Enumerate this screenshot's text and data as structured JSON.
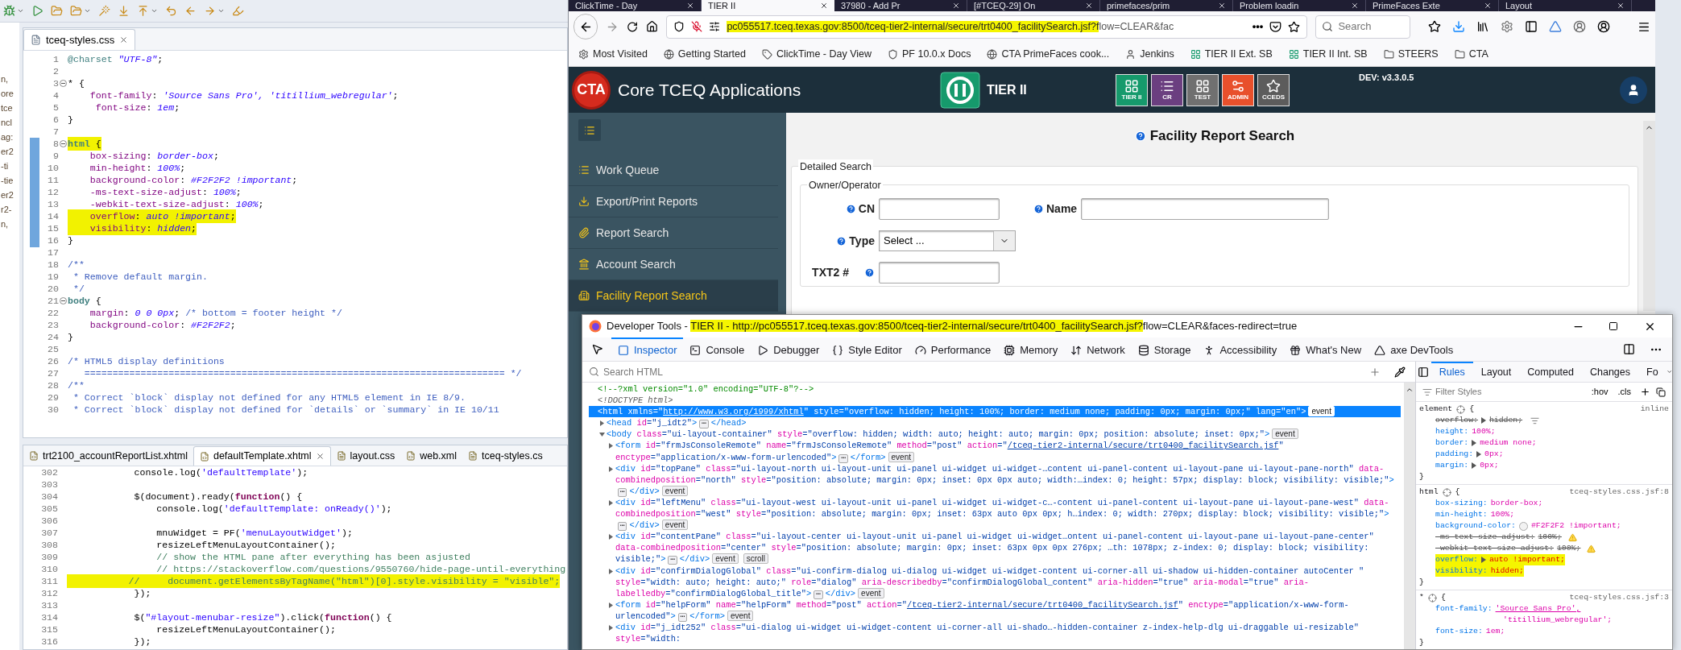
{
  "ide": {
    "explorer_fragments": [
      "n,",
      "ore",
      "tce",
      "ncl",
      "ag:",
      "er2",
      "-ti",
      "-tie",
      "er2",
      "r2-",
      "n,"
    ],
    "top_editor": {
      "tabs": [
        {
          "label": "tceq-styles.css",
          "selected": true
        }
      ],
      "lines": [
        {
          "number": "1",
          "foldable": false,
          "marked": false,
          "segments": [
            {
              "text": "@charset ",
              "kind": "at-rule"
            },
            {
              "text": "\"UTF-8\"",
              "kind": "value"
            },
            {
              "text": ";",
              "kind": "plain"
            }
          ]
        },
        {
          "number": "2",
          "foldable": false,
          "marked": false
        },
        {
          "number": "3",
          "foldable": true,
          "marked": false,
          "segments": [
            {
              "text": "* {",
              "kind": "plain"
            }
          ]
        },
        {
          "number": "4",
          "foldable": false,
          "marked": false,
          "segments": [
            {
              "text": "    font-family",
              "kind": "property"
            },
            {
              "text": ": ",
              "kind": "plain"
            },
            {
              "text": "'Source Sans Pro', 'titillium_webregular'",
              "kind": "value"
            },
            {
              "text": ";",
              "kind": "plain"
            }
          ]
        },
        {
          "number": "5",
          "foldable": false,
          "marked": false,
          "segments": [
            {
              "text": "     font-size",
              "kind": "property"
            },
            {
              "text": ": ",
              "kind": "plain"
            },
            {
              "text": "1em",
              "kind": "value"
            },
            {
              "text": ";",
              "kind": "plain"
            }
          ]
        },
        {
          "number": "6",
          "foldable": false,
          "marked": false,
          "segments": [
            {
              "text": "}",
              "kind": "plain"
            }
          ]
        },
        {
          "number": "7",
          "foldable": false,
          "marked": false
        },
        {
          "number": "8",
          "foldable": true,
          "marked": true,
          "segments": [
            {
              "text": "html",
              "kind": "selector"
            },
            {
              "text": " {",
              "kind": "plain"
            }
          ]
        },
        {
          "number": "9",
          "foldable": false,
          "marked": false,
          "segments": [
            {
              "text": "    box-sizing",
              "kind": "property"
            },
            {
              "text": ": ",
              "kind": "plain"
            },
            {
              "text": "border-box",
              "kind": "value"
            },
            {
              "text": ";",
              "kind": "plain"
            }
          ]
        },
        {
          "number": "10",
          "foldable": false,
          "marked": false,
          "segments": [
            {
              "text": "    min-height",
              "kind": "property"
            },
            {
              "text": ": ",
              "kind": "plain"
            },
            {
              "text": "100%",
              "kind": "value"
            },
            {
              "text": ";",
              "kind": "plain"
            }
          ]
        },
        {
          "number": "11",
          "foldable": false,
          "marked": false,
          "segments": [
            {
              "text": "    background-color",
              "kind": "property"
            },
            {
              "text": ": ",
              "kind": "plain"
            },
            {
              "text": "#F2F2F2 !important",
              "kind": "value"
            },
            {
              "text": ";",
              "kind": "plain"
            }
          ]
        },
        {
          "number": "12",
          "foldable": false,
          "marked": false,
          "segments": [
            {
              "text": "    -ms-text-size-adjust",
              "kind": "property"
            },
            {
              "text": ": ",
              "kind": "plain"
            },
            {
              "text": "100%",
              "kind": "value"
            },
            {
              "text": ";",
              "kind": "plain"
            }
          ]
        },
        {
          "number": "13",
          "foldable": false,
          "marked": false,
          "segments": [
            {
              "text": "    -webkit-text-size-adjust",
              "kind": "property"
            },
            {
              "text": ": ",
              "kind": "plain"
            },
            {
              "text": "100%",
              "kind": "value"
            },
            {
              "text": ";",
              "kind": "plain"
            }
          ]
        },
        {
          "number": "14",
          "foldable": false,
          "marked": true,
          "segments": [
            {
              "text": "    overflow",
              "kind": "property"
            },
            {
              "text": ": ",
              "kind": "plain"
            },
            {
              "text": "auto !important",
              "kind": "value"
            },
            {
              "text": ";",
              "kind": "plain"
            }
          ]
        },
        {
          "number": "15",
          "foldable": false,
          "marked": true,
          "segments": [
            {
              "text": "    visibility",
              "kind": "property"
            },
            {
              "text": ": ",
              "kind": "plain"
            },
            {
              "text": "hidden",
              "kind": "value"
            },
            {
              "text": ";",
              "kind": "plain"
            }
          ]
        },
        {
          "number": "16",
          "foldable": false,
          "marked": false,
          "segments": [
            {
              "text": "}",
              "kind": "plain"
            }
          ]
        },
        {
          "number": "17",
          "foldable": false,
          "marked": false
        },
        {
          "number": "18",
          "foldable": false,
          "marked": false,
          "segments": [
            {
              "text": "/**",
              "kind": "comment"
            }
          ]
        },
        {
          "number": "19",
          "foldable": false,
          "marked": false,
          "segments": [
            {
              "text": " * Remove default margin.",
              "kind": "comment"
            }
          ]
        },
        {
          "number": "20",
          "foldable": false,
          "marked": false,
          "segments": [
            {
              "text": " */",
              "kind": "comment"
            }
          ]
        },
        {
          "number": "21",
          "foldable": true,
          "marked": false,
          "segments": [
            {
              "text": "body",
              "kind": "selector"
            },
            {
              "text": " {",
              "kind": "plain"
            }
          ]
        },
        {
          "number": "22",
          "foldable": false,
          "marked": false,
          "segments": [
            {
              "text": "    margin",
              "kind": "property"
            },
            {
              "text": ": ",
              "kind": "plain"
            },
            {
              "text": "0 0 0px",
              "kind": "value"
            },
            {
              "text": "; ",
              "kind": "plain"
            },
            {
              "text": "/* bottom = footer height */",
              "kind": "comment"
            }
          ]
        },
        {
          "number": "23",
          "foldable": false,
          "marked": false,
          "segments": [
            {
              "text": "    background-color",
              "kind": "property"
            },
            {
              "text": ": ",
              "kind": "plain"
            },
            {
              "text": "#F2F2F2",
              "kind": "value"
            },
            {
              "text": ";",
              "kind": "plain"
            }
          ]
        },
        {
          "number": "24",
          "foldable": false,
          "marked": false,
          "segments": [
            {
              "text": "}",
              "kind": "plain"
            }
          ]
        },
        {
          "number": "25",
          "foldable": false,
          "marked": false
        },
        {
          "number": "26",
          "foldable": false,
          "marked": false,
          "segments": [
            {
              "text": "/* HTML5 display definitions",
              "kind": "comment"
            }
          ]
        },
        {
          "number": "27",
          "foldable": false,
          "marked": false,
          "segments": [
            {
              "text": "   =========================================================================== */",
              "kind": "comment"
            }
          ]
        },
        {
          "number": "28",
          "foldable": false,
          "marked": false,
          "segments": [
            {
              "text": "/**",
              "kind": "comment"
            }
          ]
        },
        {
          "number": "29",
          "foldable": false,
          "marked": false,
          "segments": [
            {
              "text": " * Correct `block` display not defined for any HTML5 element in IE 8/9.",
              "kind": "comment"
            }
          ]
        },
        {
          "number": "30",
          "foldable": false,
          "marked": false,
          "segments": [
            {
              "text": " * Correct `block` display not defined for `details` or `summary` in IE 10/11",
              "kind": "comment"
            }
          ]
        }
      ]
    },
    "bottom_editor": {
      "tabs": [
        {
          "label": "trt2100_accountReportList.xhtml",
          "selected": false
        },
        {
          "label": "defaultTemplate.xhtml",
          "selected": true
        },
        {
          "label": "layout.css",
          "selected": false
        },
        {
          "label": "web.xml",
          "selected": false
        },
        {
          "label": "tceq-styles.cs",
          "selected": false
        }
      ],
      "lines": [
        {
          "number": "302",
          "foldable": false,
          "marked": false,
          "segments": [
            {
              "text": "            console.log(",
              "kind": "plain"
            },
            {
              "text": "'defaultTemplate'",
              "kind": "string"
            },
            {
              "text": ");",
              "kind": "plain"
            }
          ]
        },
        {
          "number": "303",
          "foldable": false,
          "marked": false
        },
        {
          "number": "304",
          "foldable": false,
          "marked": false,
          "segments": [
            {
              "text": "            $(document).ready(",
              "kind": "plain"
            },
            {
              "text": "function",
              "kind": "keyword"
            },
            {
              "text": "() {",
              "kind": "plain"
            }
          ]
        },
        {
          "number": "305",
          "foldable": false,
          "marked": false,
          "segments": [
            {
              "text": "                console.log(",
              "kind": "plain"
            },
            {
              "text": "'defaultTemplate: onReady()'",
              "kind": "string"
            },
            {
              "text": ");",
              "kind": "plain"
            }
          ]
        },
        {
          "number": "306",
          "foldable": false,
          "marked": false
        },
        {
          "number": "307",
          "foldable": false,
          "marked": false,
          "segments": [
            {
              "text": "                mnuWidget = PF(",
              "kind": "plain"
            },
            {
              "text": "'menuLayoutWidget'",
              "kind": "string"
            },
            {
              "text": ");",
              "kind": "plain"
            }
          ]
        },
        {
          "number": "308",
          "foldable": false,
          "marked": false,
          "segments": [
            {
              "text": "                resizeLeftMenuLayoutContainer();",
              "kind": "plain"
            }
          ]
        },
        {
          "number": "309",
          "foldable": false,
          "marked": false,
          "segments": [
            {
              "text": "                // show the HTML pane after everything has been asjusted",
              "kind": "line-comment"
            }
          ]
        },
        {
          "number": "310",
          "foldable": false,
          "marked": false,
          "segments": [
            {
              "text": "                // https://stackoverflow.com/questions/9550760/hide-page-until-everything",
              "kind": "line-comment"
            }
          ]
        },
        {
          "number": "311",
          "foldable": false,
          "marked": true,
          "segments": [
            {
              "text": "           //     document.getElementsByTagName(\"html\")[0].style.visibility = \"visible\";",
              "kind": "line-comment"
            }
          ]
        },
        {
          "number": "312",
          "foldable": false,
          "marked": false,
          "segments": [
            {
              "text": "            });",
              "kind": "plain"
            }
          ]
        },
        {
          "number": "313",
          "foldable": false,
          "marked": false
        },
        {
          "number": "314",
          "foldable": false,
          "marked": false,
          "segments": [
            {
              "text": "            $(",
              "kind": "plain"
            },
            {
              "text": "\"#layout-menubar-resize\"",
              "kind": "string"
            },
            {
              "text": ").click(",
              "kind": "plain"
            },
            {
              "text": "function",
              "kind": "keyword"
            },
            {
              "text": "() {",
              "kind": "plain"
            }
          ]
        },
        {
          "number": "315",
          "foldable": false,
          "marked": false,
          "segments": [
            {
              "text": "                resizeLeftMenuLayoutContainer();",
              "kind": "plain"
            }
          ]
        },
        {
          "number": "316",
          "foldable": false,
          "marked": false,
          "segments": [
            {
              "text": "            });",
              "kind": "plain"
            }
          ]
        }
      ]
    }
  },
  "browser": {
    "tabs": [
      {
        "label": "ClickTime - Day",
        "selected": false
      },
      {
        "label": "TIER II",
        "selected": true
      },
      {
        "label": "37980 - Add Pr",
        "selected": false
      },
      {
        "label": "[#TCEQ-29] On",
        "selected": false
      },
      {
        "label": "primefaces/prim",
        "selected": false
      },
      {
        "label": "Problem loadin",
        "selected": false
      },
      {
        "label": "PrimeFaces Exte",
        "selected": false
      },
      {
        "label": "Layout",
        "selected": false
      }
    ],
    "url": {
      "marked": "pc055517.tceq.texas.gov:8500/tceq-tier2-internal/secure/trt0400_facilitySearch.jsf?f",
      "rest": "low=CLEAR&fac"
    },
    "more": "•••",
    "search": {
      "placeholder": "Search"
    },
    "bookmarks": [
      "Most Visited",
      "Getting Started",
      "ClickTime - Day View",
      "PF 10.0.x Docs",
      "CTA PrimeFaces cook...",
      "Jenkins",
      "TIER II Ext. SB",
      "TIER II Int. SB",
      "STEERS",
      "CTA"
    ],
    "app": {
      "logo": "CTA",
      "title": "Core TCEQ Applications",
      "module": "TIER II",
      "tiles": [
        {
          "label": "TIER II",
          "color": "#169a6c"
        },
        {
          "label": "CR",
          "color": "#6b3f80"
        },
        {
          "label": "TEST",
          "color": "#707070"
        },
        {
          "label": "ADMIN",
          "color": "#e8502c"
        },
        {
          "label": "CCEDS",
          "color": "#5c5c5c"
        }
      ],
      "version": "DEV: v3.3.0.5",
      "menu": [
        {
          "label": "Work Queue",
          "selected": false
        },
        {
          "label": "Export/Print Reports",
          "selected": false
        },
        {
          "label": "Report Search",
          "selected": false
        },
        {
          "label": "Account Search",
          "selected": false
        },
        {
          "label": "Facility Report Search",
          "selected": true
        }
      ],
      "page_title": "Facility Report Search",
      "section": "Detailed Search",
      "group": "Owner/Operator",
      "fields": [
        {
          "label": "CN",
          "kind": "text",
          "help_after": false
        },
        {
          "label": "Name",
          "kind": "text",
          "help_after": false
        },
        {
          "label": "Type",
          "kind": "select",
          "help_after": false,
          "value": "Select ..."
        },
        {
          "label": "TXT2 #",
          "kind": "text",
          "help_after": true
        }
      ]
    }
  },
  "devtools": {
    "title": {
      "prefix": "Developer Tools - ",
      "marked": "TIER II - http://pc055517.tceq.texas.gov:8500/tceq-tier2-internal/secure/trt0400_facilitySearch.jsf?",
      "rest": "flow=CLEAR&faces-redirect=true"
    },
    "tabs": [
      {
        "label": "Inspector",
        "selected": true
      },
      {
        "label": "Console",
        "selected": false
      },
      {
        "label": "Debugger",
        "selected": false
      },
      {
        "label": "Style Editor",
        "selected": false
      },
      {
        "label": "Performance",
        "selected": false
      },
      {
        "label": "Memory",
        "selected": false
      },
      {
        "label": "Network",
        "selected": false
      },
      {
        "label": "Storage",
        "selected": false
      },
      {
        "label": "Accessibility",
        "selected": false
      },
      {
        "label": "What's New",
        "selected": false
      },
      {
        "label": "axe DevTools",
        "selected": false
      }
    ],
    "search": {
      "placeholder": "Search HTML"
    },
    "tree": [
      {
        "markup": "<!--?xml version=\"1.0\" encoding=\"UTF-8\"?-->",
        "selected": false
      },
      {
        "markup": "<!DOCTYPE html>",
        "selected": false
      },
      {
        "markup": "<html xmlns=\"http://www.w3.org/1999/xhtml\" style=\"overflow: hidden; height: 100%; border: medium none; padding: 0px; margin: 0px;\" lang=\"en\">",
        "badges": [
          "event"
        ],
        "selected": true,
        "children": [
          {
            "markup": "<head id=\"j_idt2\">",
            "ellipsis": "⋯",
            "closing": "</head>",
            "expanded": false,
            "selected": false
          },
          {
            "markup": "<body class=\"ui-layout-container\" style=\"overflow: hidden; width: auto; height: auto; margin: 0px; position: absolute; inset: 0px;\">",
            "badges": [
              "event"
            ],
            "expanded": true,
            "selected": false,
            "children": [
              {
                "markup": "<form id=\"frmJsConsoleRemote\" name=\"frmJsConsoleRemote\" method=\"post\" action=\"/tceq-tier2-internal/secure/trt0400_facilitySearch.jsf\" enctype=\"application/x-www-form-urlencoded\">",
                "ellipsis": "⋯",
                "closing": "</form>",
                "badges": [
                  "event"
                ],
                "expanded": false,
                "selected": false
              },
              {
                "markup": "<div id=\"topPane\" class=\"ui-layout-north ui-layout-unit ui-panel ui-widget ui-widget-…content ui-panel-content ui-layout-pane ui-layout-pane-north\" data-combinedposition=\"north\" style=\"position: absolute; margin: 0px; inset: 0px 0px auto; width:…index: 0; height: 57px; display: block; visibility: visible;\">",
                "ellipsis": "⋯",
                "closing": "</div>",
                "badges": [
                  "event"
                ],
                "expanded": false,
                "selected": false
              },
              {
                "markup": "<div id=\"leftMenu\" class=\"ui-layout-west ui-layout-unit ui-panel ui-widget ui-widget-c…-content ui-panel-content ui-layout-pane ui-layout-pane-west\" data-combinedposition=\"west\" style=\"position: absolute; margin: 0px; inset: 63px auto 0px 0px; h…index: 0; width: 270px; display: block; visibility: visible;\">",
                "ellipsis": "⋯",
                "closing": "</div>",
                "badges": [
                  "event"
                ],
                "expanded": false,
                "selected": false
              },
              {
                "markup": "<div id=\"contentPane\" class=\"ui-layout-center ui-layout-unit ui-panel ui-widget ui-widget…ontent ui-panel-content ui-layout-pane ui-layout-pane-center\" data-combinedposition=\"center\" style=\"position: absolute; margin: 0px; inset: 63px 0px 0px 276px; …th: 1078px; z-index: 0; display: block; visibility: visible;\">",
                "ellipsis": "⋯",
                "closing": "</div>",
                "badges": [
                  "event",
                  "scroll"
                ],
                "expanded": false,
                "selected": false
              },
              {
                "markup": "<div id=\"confirmDialogGlobal\" class=\"ui-confirm-dialog ui-dialog ui-widget ui-widget-content ui-corner-all ui-shadow ui-hidden-container autoCenter \" style=\"width: auto; height: auto;\" role=\"dialog\" aria-describedby=\"confirmDialogGlobal_content\" aria-hidden=\"true\" aria-modal=\"true\" aria-labelledby=\"confirmDialogGlobal_title\">",
                "ellipsis": "⋯",
                "closing": "</div>",
                "badges": [
                  "event"
                ],
                "expanded": false,
                "selected": false
              },
              {
                "markup": "<form id=\"helpForm\" name=\"helpForm\" method=\"post\" action=\"/tceq-tier2-internal/secure/trt0400_facilitySearch.jsf\" enctype=\"application/x-www-form-urlencoded\">",
                "ellipsis": "⋯",
                "closing": "</form>",
                "badges": [
                  "event"
                ],
                "expanded": false,
                "selected": false
              },
              {
                "markup": "<div id=\"j_idt252\" class=\"ui-dialog ui-widget ui-widget-content ui-corner-all ui-shado…-hidden-container z-index-help-dlg ui-draggable ui-resizable\" style=\"width:",
                "expanded": false,
                "selected": false
              }
            ]
          }
        ]
      }
    ],
    "side_tabs": [
      {
        "label": "Rules",
        "selected": true
      },
      {
        "label": "Layout",
        "selected": false
      },
      {
        "label": "Computed",
        "selected": false
      },
      {
        "label": "Changes",
        "selected": false
      },
      {
        "label": "Fo",
        "selected": false
      }
    ],
    "filter": {
      "placeholder": "Filter Styles"
    },
    "pseudo_toggles": [
      ":hov",
      ".cls"
    ],
    "rules": [
      {
        "selector": "element",
        "open": "{",
        "close": "}",
        "source": "inline",
        "declarations": [
          {
            "property": "overflow:",
            "value": "hidden;",
            "kind": "plain",
            "overridden": true,
            "expandable": true,
            "warning": false,
            "marked": false
          },
          {
            "property": "height:",
            "value": "100%;",
            "kind": "plain",
            "overridden": false,
            "expandable": false,
            "warning": false,
            "marked": false
          },
          {
            "property": "border:",
            "value": "medium none;",
            "kind": "plain",
            "overridden": false,
            "expandable": true,
            "warning": false,
            "marked": false
          },
          {
            "property": "padding:",
            "value": "0px;",
            "kind": "plain",
            "overridden": false,
            "expandable": true,
            "warning": false,
            "marked": false
          },
          {
            "property": "margin:",
            "value": "0px;",
            "kind": "plain",
            "overridden": false,
            "expandable": true,
            "warning": false,
            "marked": false
          }
        ]
      },
      {
        "selector": "html",
        "open": "{",
        "close": "}",
        "source": "tceq-styles.css.jsf:8",
        "declarations": [
          {
            "property": "box-sizing:",
            "value": "border-box;",
            "kind": "plain",
            "overridden": false,
            "expandable": false,
            "warning": false,
            "marked": false
          },
          {
            "property": "min-height:",
            "value": "100%;",
            "kind": "plain",
            "overridden": false,
            "expandable": false,
            "warning": false,
            "marked": false
          },
          {
            "property": "background-color:",
            "value": "#F2F2F2 !important;",
            "kind": "color",
            "overridden": false,
            "expandable": false,
            "warning": false,
            "marked": false
          },
          {
            "property": "-ms-text-size-adjust:",
            "value": "100%;",
            "kind": "plain",
            "overridden": true,
            "expandable": false,
            "warning": true,
            "marked": false
          },
          {
            "property": "-webkit-text-size-adjust:",
            "value": "100%;",
            "kind": "plain",
            "overridden": true,
            "expandable": false,
            "warning": true,
            "marked": false
          },
          {
            "property": "overflow:",
            "value": "auto !important;",
            "kind": "plain",
            "overridden": false,
            "expandable": true,
            "warning": false,
            "marked": true
          },
          {
            "property": "visibility:",
            "value": "hidden;",
            "kind": "plain",
            "overridden": false,
            "expandable": false,
            "warning": false,
            "marked": true
          }
        ]
      },
      {
        "selector": "*",
        "open": "{",
        "close": "}",
        "source": "tceq-styles.css.jsf:3",
        "declarations": [
          {
            "property": "font-family:",
            "value": "'Source Sans Pro',",
            "continued": "'titillium_webregular';",
            "kind": "font",
            "overridden": false,
            "expandable": false,
            "warning": false,
            "marked": false
          },
          {
            "property": "font-size:",
            "value": "1em;",
            "kind": "plain",
            "overridden": false,
            "expandable": false,
            "warning": false,
            "marked": false
          }
        ]
      }
    ]
  }
}
